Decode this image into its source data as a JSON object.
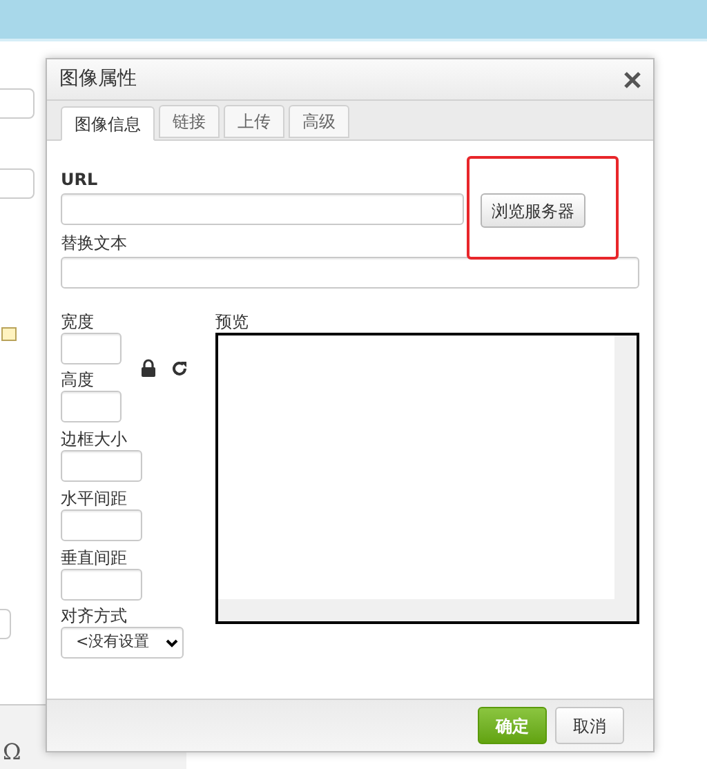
{
  "background": {
    "toolbar_symbol": "Ω"
  },
  "dialog": {
    "title": "图像属性",
    "tabs": [
      {
        "label": "图像信息",
        "selected": true
      },
      {
        "label": "链接",
        "selected": false
      },
      {
        "label": "上传",
        "selected": false
      },
      {
        "label": "高级",
        "selected": false
      }
    ],
    "url": {
      "label": "URL"
    },
    "browse_button": {
      "label": "浏览服务器",
      "highlighted": true
    },
    "alt_text": {
      "label": "替换文本"
    },
    "width": {
      "label": "宽度"
    },
    "height": {
      "label": "高度"
    },
    "preview": {
      "label": "预览"
    },
    "small_fields": [
      {
        "label": "边框大小"
      },
      {
        "label": "水平间距"
      },
      {
        "label": "垂直间距"
      }
    ],
    "align": {
      "label": "对齐方式",
      "value": "<没有设置"
    },
    "buttons": [
      {
        "label": "确定",
        "kind": "primary"
      },
      {
        "label": "取消",
        "kind": "secondary"
      }
    ]
  }
}
